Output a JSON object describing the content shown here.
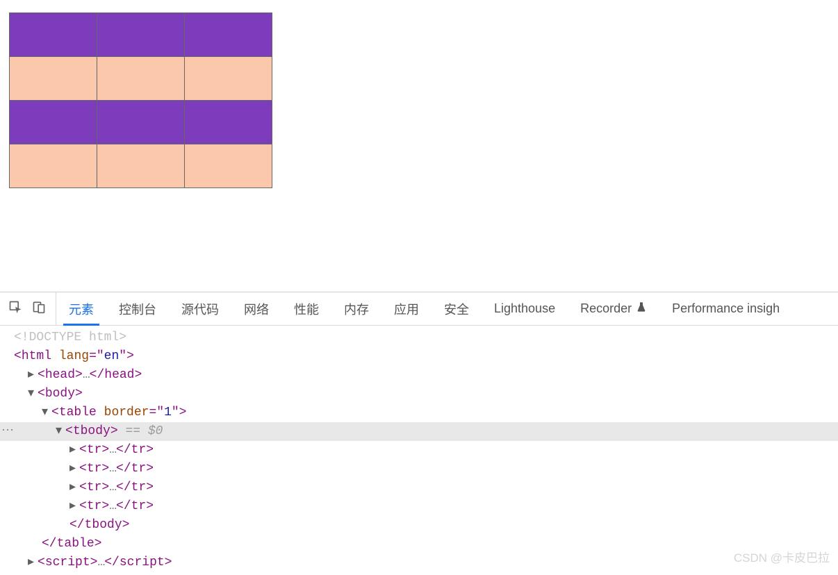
{
  "table": {
    "rows": 4,
    "cols": 3,
    "colors": {
      "odd": "#7c3cbb",
      "even": "#fbc8ab"
    }
  },
  "devtools": {
    "tabs": [
      "元素",
      "控制台",
      "源代码",
      "网络",
      "性能",
      "内存",
      "应用",
      "安全",
      "Lighthouse",
      "Recorder",
      "Performance insigh"
    ],
    "active_tab_index": 0
  },
  "dom": {
    "doctype": "<!DOCTYPE html>",
    "html_open": "<html lang=\"en\">",
    "head": "<head>…</head>",
    "body_open": "<body>",
    "table_open": "<table border=\"1\">",
    "tbody_open": "<tbody>",
    "eq0": " == $0",
    "tr": "<tr>…</tr>",
    "tbody_close": "</tbody>",
    "table_close": "</table>",
    "script": "<script>…</scrip",
    "script_suffix": "t>"
  },
  "watermark": "CSDN @卡皮巴拉"
}
